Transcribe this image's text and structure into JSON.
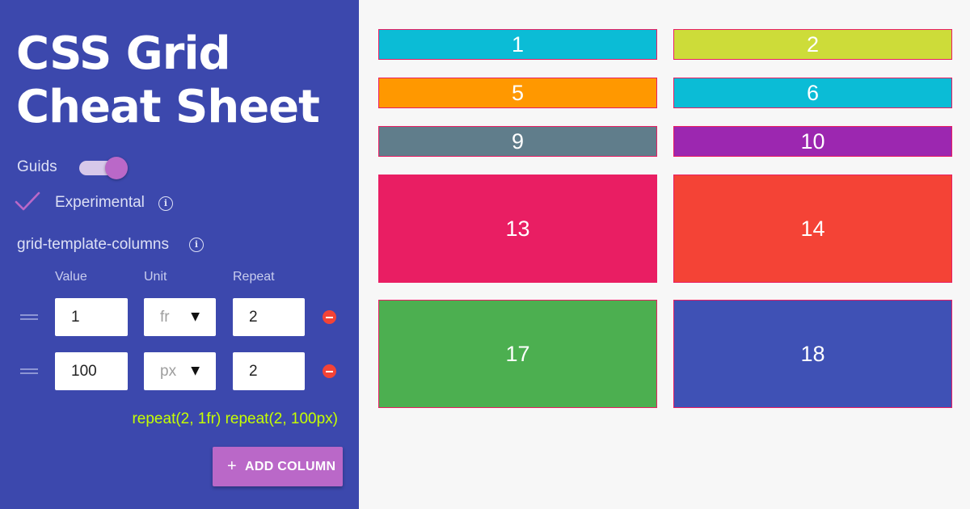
{
  "sidebar": {
    "title_line1": "CSS Grid",
    "title_line2": "Cheat Sheet",
    "guids_label": "Guids",
    "guids_on": true,
    "experimental_label": "Experimental",
    "experimental_checked": true,
    "info_icon": "i",
    "property_label": "grid-template-columns",
    "column_headers": {
      "value": "Value",
      "unit": "Unit",
      "repeat": "Repeat"
    },
    "rows": [
      {
        "value": "1",
        "unit": "fr",
        "repeat": "2"
      },
      {
        "value": "100",
        "unit": "px",
        "repeat": "2"
      }
    ],
    "dropdown_caret": "▼",
    "result": "repeat(2, 1fr) repeat(2, 100px)",
    "add_button": {
      "icon": "+",
      "label": "ADD COLUMN"
    }
  },
  "grid_items": [
    {
      "label": "1",
      "color": "#0bbcd6"
    },
    {
      "label": "2",
      "color": "#cddc39"
    },
    {
      "label": "5",
      "color": "#ff9800"
    },
    {
      "label": "6",
      "color": "#0bbcd6"
    },
    {
      "label": "9",
      "color": "#607d8b"
    },
    {
      "label": "10",
      "color": "#9c27b0"
    },
    {
      "label": "13",
      "color": "#e91e63"
    },
    {
      "label": "14",
      "color": "#f44336"
    },
    {
      "label": "17",
      "color": "#4caf50"
    },
    {
      "label": "18",
      "color": "#3f51b5"
    }
  ],
  "colors": {
    "panel_bg": "#3c48ad",
    "accent": "#ba68c8",
    "result_text": "#c6ff00",
    "remove": "#f44336",
    "cell_border": "#e91e63"
  }
}
